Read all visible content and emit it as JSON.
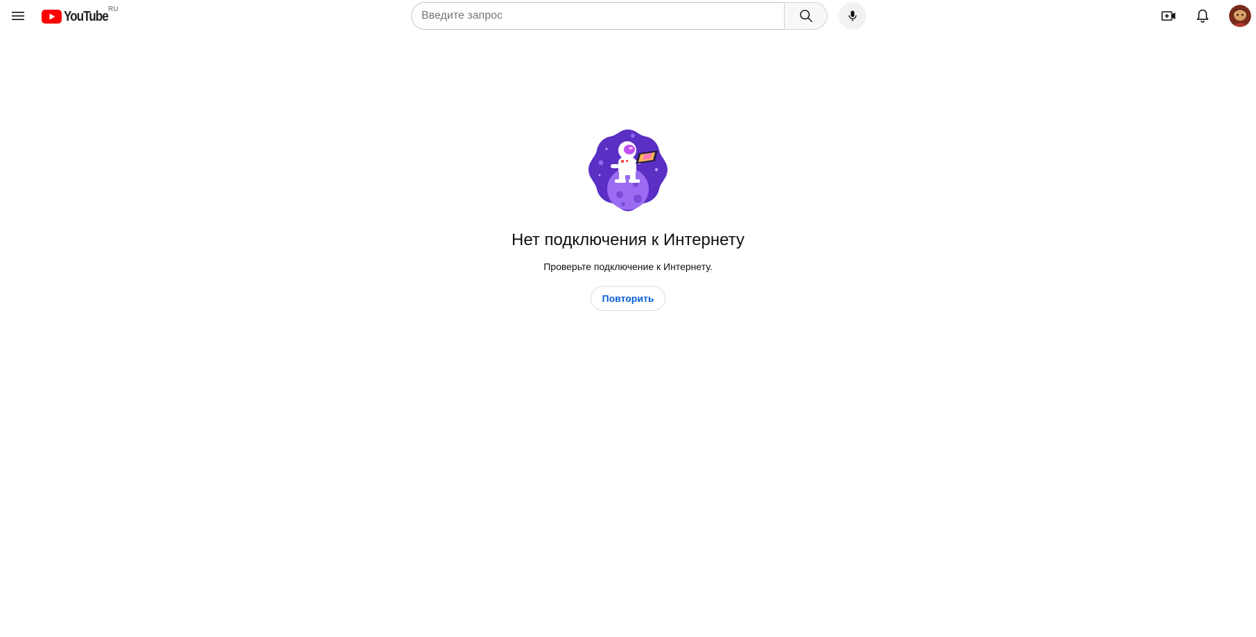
{
  "header": {
    "menu_icon": "hamburger-menu-icon",
    "logo_text": "YouTube",
    "logo_region": "RU",
    "brand_color": "#ff0000",
    "search": {
      "placeholder": "Введите запрос",
      "value": "",
      "button_icon": "search-icon"
    },
    "mic_icon": "microphone-icon",
    "create_icon": "create-video-icon",
    "notifications_icon": "bell-icon",
    "avatar_icon": "user-avatar"
  },
  "error": {
    "illustration": "astronaut-on-planet-illustration",
    "title": "Нет подключения к Интернету",
    "message": "Проверьте подключение к Интернету.",
    "retry_label": "Повторить",
    "retry_color": "#065fd4"
  }
}
